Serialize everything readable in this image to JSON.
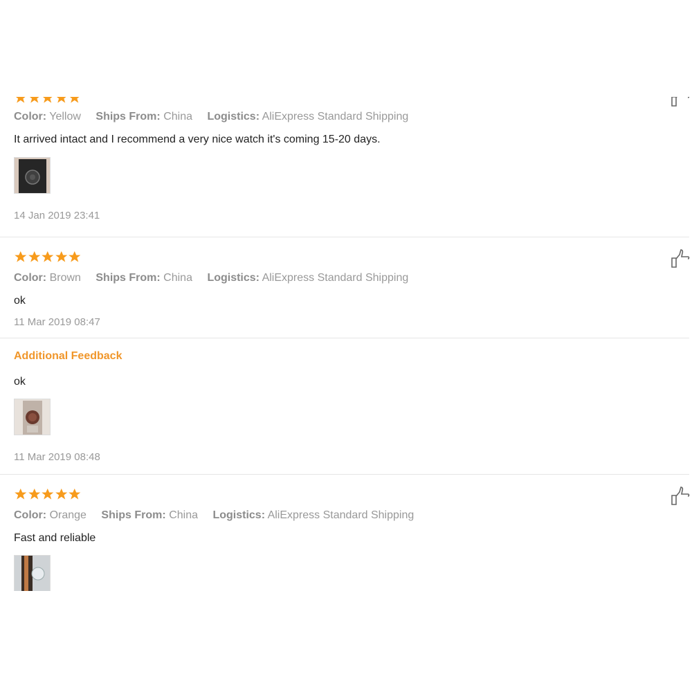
{
  "reviews": [
    {
      "rating": 5,
      "meta": {
        "color_label": "Color:",
        "color": "Yellow",
        "ships_label": "Ships From:",
        "ships": "China",
        "logistics_label": "Logistics:",
        "logistics": "AliExpress Standard Shipping"
      },
      "text": "It arrived intact and I recommend a very nice watch it's coming 15-20 days.",
      "photo": "watch-photo",
      "date": "14 Jan 2019 23:41"
    },
    {
      "rating": 5,
      "meta": {
        "color_label": "Color:",
        "color": "Brown",
        "ships_label": "Ships From:",
        "ships": "China",
        "logistics_label": "Logistics:",
        "logistics": "AliExpress Standard Shipping"
      },
      "text": "ok",
      "date": "11 Mar 2019 08:47",
      "additional": {
        "heading": "Additional Feedback",
        "text": "ok",
        "photo": "watch-photo",
        "date": "11 Mar 2019 08:48"
      }
    },
    {
      "rating": 5,
      "meta": {
        "color_label": "Color:",
        "color": "Orange",
        "ships_label": "Ships From:",
        "ships": "China",
        "logistics_label": "Logistics:",
        "logistics": "AliExpress Standard Shipping"
      },
      "text": "Fast and reliable",
      "photo": "watch-photo"
    }
  ],
  "colors": {
    "star": "#f79b1c",
    "additional_heading": "#f0962a",
    "muted_text": "#999999"
  },
  "icons": {
    "rating": "star-icon",
    "helpful": "thumbs-up-icon"
  }
}
